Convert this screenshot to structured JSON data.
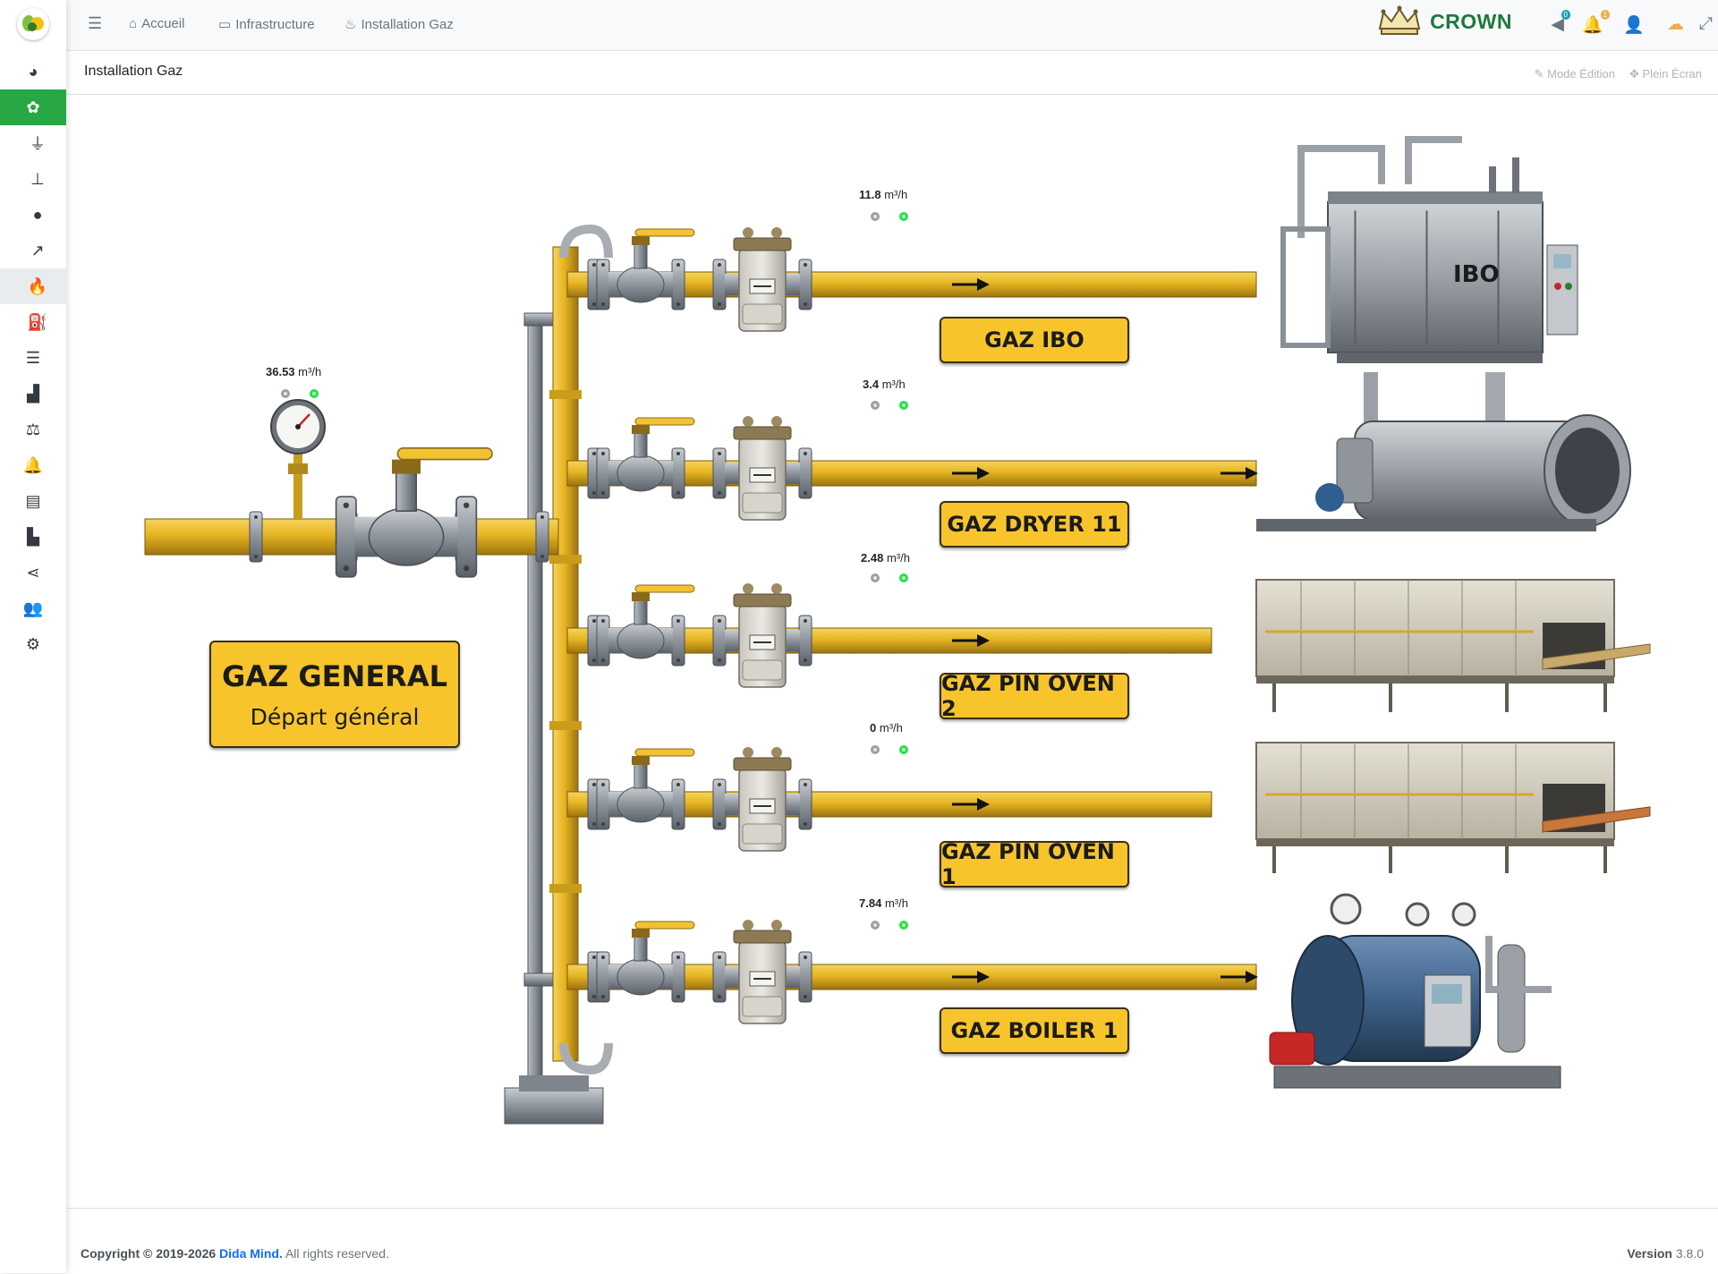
{
  "app": {
    "brand_name": "CROWN"
  },
  "breadcrumb": [
    {
      "label": "Accueil",
      "icon": "home-icon"
    },
    {
      "label": "Infrastructure",
      "icon": "server-icon"
    },
    {
      "label": "Installation Gaz",
      "icon": "flame-icon"
    }
  ],
  "topbar": {
    "notifications_badge_1": "0",
    "notifications_badge_2": "1"
  },
  "page": {
    "title": "Installation Gaz",
    "edit_mode_label": "Mode Édition",
    "fullscreen_label": "Plein Écran"
  },
  "sidebar": {
    "items": [
      {
        "icon": "dashboard-icon"
      },
      {
        "icon": "network-icon",
        "active": true
      },
      {
        "icon": "plug-icon"
      },
      {
        "icon": "sitemap-icon"
      },
      {
        "icon": "globe-icon"
      },
      {
        "icon": "line-chart-icon"
      },
      {
        "icon": "flame-icon",
        "selected": true
      },
      {
        "icon": "faucet-icon"
      },
      {
        "icon": "server-stack-icon"
      },
      {
        "icon": "area-chart-icon"
      },
      {
        "icon": "balance-icon"
      },
      {
        "icon": "bell-icon"
      },
      {
        "icon": "invoice-icon"
      },
      {
        "icon": "factory-icon"
      },
      {
        "icon": "share-icon"
      },
      {
        "icon": "users-icon"
      },
      {
        "icon": "settings-icon"
      }
    ]
  },
  "diagram": {
    "unit": "m³/h",
    "general": {
      "title": "GAZ GENERAL",
      "subtitle": "Départ général",
      "value": "36.53"
    },
    "lines": [
      {
        "label": "GAZ IBO",
        "value": "11.8",
        "equipment": "IBO"
      },
      {
        "label": "GAZ DRYER 11",
        "value": "3.4"
      },
      {
        "label": "GAZ PIN OVEN 2",
        "value": "2.48"
      },
      {
        "label": "GAZ PIN OVEN 1",
        "value": "0"
      },
      {
        "label": "GAZ BOILER 1",
        "value": "7.84"
      }
    ]
  },
  "footer": {
    "copyright_prefix": "Copyright © 2019-2026",
    "company": "Dida Mind.",
    "rights": "All rights reserved.",
    "version_label": "Version",
    "version": "3.8.0"
  },
  "colors": {
    "accent": "#28a745",
    "pipe": "#e8b82a",
    "label_bg": "#f7c52b",
    "brand": "#1d7a3a"
  }
}
